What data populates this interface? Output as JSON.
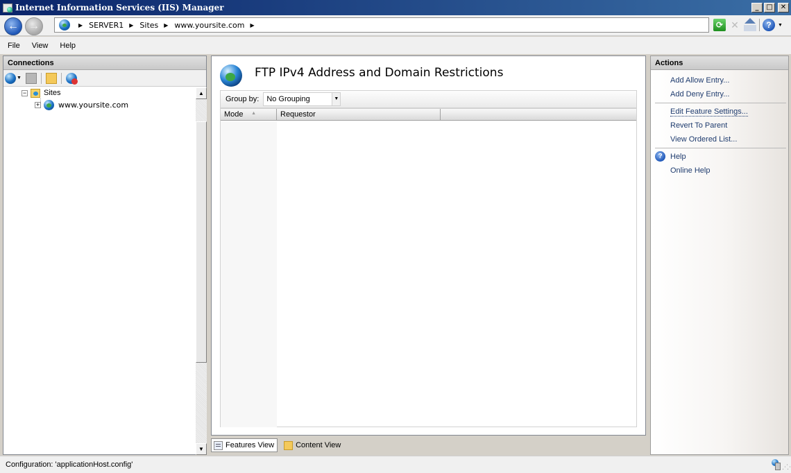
{
  "window": {
    "title": "Internet Information Services (IIS) Manager"
  },
  "address": {
    "breadcrumbs": [
      "SERVER1",
      "Sites",
      "www.yoursite.com"
    ]
  },
  "menu": [
    "File",
    "View",
    "Help"
  ],
  "connections": {
    "header": "Connections",
    "tree": {
      "sites_label": "Sites",
      "site_label": "www.yoursite.com"
    }
  },
  "feature": {
    "title": "FTP IPv4 Address and Domain Restrictions",
    "group_by_label": "Group by:",
    "group_by_value": "No Grouping",
    "columns": [
      "Mode",
      "Requestor"
    ]
  },
  "view_tabs": {
    "features": "Features View",
    "content": "Content View"
  },
  "actions": {
    "header": "Actions",
    "add_allow": "Add Allow Entry...",
    "add_deny": "Add Deny Entry...",
    "edit_settings": "Edit Feature Settings...",
    "revert": "Revert To Parent",
    "view_ordered": "View Ordered List...",
    "help": "Help",
    "online_help": "Online Help"
  },
  "status": {
    "text": "Configuration: 'applicationHost.config'"
  }
}
